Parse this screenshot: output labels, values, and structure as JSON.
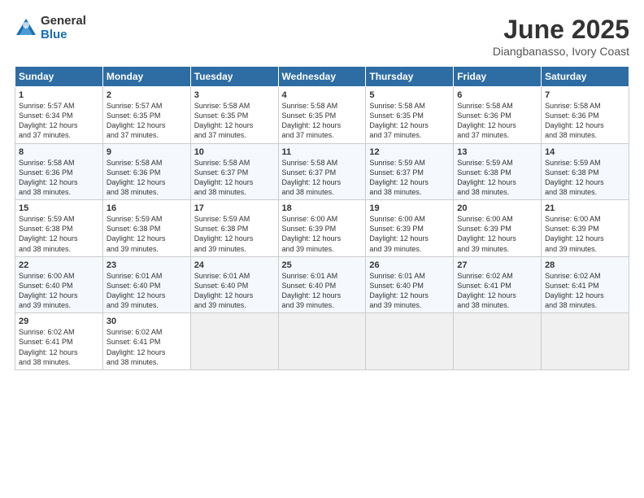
{
  "logo": {
    "general": "General",
    "blue": "Blue"
  },
  "title": "June 2025",
  "subtitle": "Diangbanasso, Ivory Coast",
  "header_days": [
    "Sunday",
    "Monday",
    "Tuesday",
    "Wednesday",
    "Thursday",
    "Friday",
    "Saturday"
  ],
  "weeks": [
    [
      {
        "day": "1",
        "lines": [
          "Sunrise: 5:57 AM",
          "Sunset: 6:34 PM",
          "Daylight: 12 hours",
          "and 37 minutes."
        ]
      },
      {
        "day": "2",
        "lines": [
          "Sunrise: 5:57 AM",
          "Sunset: 6:35 PM",
          "Daylight: 12 hours",
          "and 37 minutes."
        ]
      },
      {
        "day": "3",
        "lines": [
          "Sunrise: 5:58 AM",
          "Sunset: 6:35 PM",
          "Daylight: 12 hours",
          "and 37 minutes."
        ]
      },
      {
        "day": "4",
        "lines": [
          "Sunrise: 5:58 AM",
          "Sunset: 6:35 PM",
          "Daylight: 12 hours",
          "and 37 minutes."
        ]
      },
      {
        "day": "5",
        "lines": [
          "Sunrise: 5:58 AM",
          "Sunset: 6:35 PM",
          "Daylight: 12 hours",
          "and 37 minutes."
        ]
      },
      {
        "day": "6",
        "lines": [
          "Sunrise: 5:58 AM",
          "Sunset: 6:36 PM",
          "Daylight: 12 hours",
          "and 37 minutes."
        ]
      },
      {
        "day": "7",
        "lines": [
          "Sunrise: 5:58 AM",
          "Sunset: 6:36 PM",
          "Daylight: 12 hours",
          "and 38 minutes."
        ]
      }
    ],
    [
      {
        "day": "8",
        "lines": [
          "Sunrise: 5:58 AM",
          "Sunset: 6:36 PM",
          "Daylight: 12 hours",
          "and 38 minutes."
        ]
      },
      {
        "day": "9",
        "lines": [
          "Sunrise: 5:58 AM",
          "Sunset: 6:36 PM",
          "Daylight: 12 hours",
          "and 38 minutes."
        ]
      },
      {
        "day": "10",
        "lines": [
          "Sunrise: 5:58 AM",
          "Sunset: 6:37 PM",
          "Daylight: 12 hours",
          "and 38 minutes."
        ]
      },
      {
        "day": "11",
        "lines": [
          "Sunrise: 5:58 AM",
          "Sunset: 6:37 PM",
          "Daylight: 12 hours",
          "and 38 minutes."
        ]
      },
      {
        "day": "12",
        "lines": [
          "Sunrise: 5:59 AM",
          "Sunset: 6:37 PM",
          "Daylight: 12 hours",
          "and 38 minutes."
        ]
      },
      {
        "day": "13",
        "lines": [
          "Sunrise: 5:59 AM",
          "Sunset: 6:38 PM",
          "Daylight: 12 hours",
          "and 38 minutes."
        ]
      },
      {
        "day": "14",
        "lines": [
          "Sunrise: 5:59 AM",
          "Sunset: 6:38 PM",
          "Daylight: 12 hours",
          "and 38 minutes."
        ]
      }
    ],
    [
      {
        "day": "15",
        "lines": [
          "Sunrise: 5:59 AM",
          "Sunset: 6:38 PM",
          "Daylight: 12 hours",
          "and 38 minutes."
        ]
      },
      {
        "day": "16",
        "lines": [
          "Sunrise: 5:59 AM",
          "Sunset: 6:38 PM",
          "Daylight: 12 hours",
          "and 39 minutes."
        ]
      },
      {
        "day": "17",
        "lines": [
          "Sunrise: 5:59 AM",
          "Sunset: 6:38 PM",
          "Daylight: 12 hours",
          "and 39 minutes."
        ]
      },
      {
        "day": "18",
        "lines": [
          "Sunrise: 6:00 AM",
          "Sunset: 6:39 PM",
          "Daylight: 12 hours",
          "and 39 minutes."
        ]
      },
      {
        "day": "19",
        "lines": [
          "Sunrise: 6:00 AM",
          "Sunset: 6:39 PM",
          "Daylight: 12 hours",
          "and 39 minutes."
        ]
      },
      {
        "day": "20",
        "lines": [
          "Sunrise: 6:00 AM",
          "Sunset: 6:39 PM",
          "Daylight: 12 hours",
          "and 39 minutes."
        ]
      },
      {
        "day": "21",
        "lines": [
          "Sunrise: 6:00 AM",
          "Sunset: 6:39 PM",
          "Daylight: 12 hours",
          "and 39 minutes."
        ]
      }
    ],
    [
      {
        "day": "22",
        "lines": [
          "Sunrise: 6:00 AM",
          "Sunset: 6:40 PM",
          "Daylight: 12 hours",
          "and 39 minutes."
        ]
      },
      {
        "day": "23",
        "lines": [
          "Sunrise: 6:01 AM",
          "Sunset: 6:40 PM",
          "Daylight: 12 hours",
          "and 39 minutes."
        ]
      },
      {
        "day": "24",
        "lines": [
          "Sunrise: 6:01 AM",
          "Sunset: 6:40 PM",
          "Daylight: 12 hours",
          "and 39 minutes."
        ]
      },
      {
        "day": "25",
        "lines": [
          "Sunrise: 6:01 AM",
          "Sunset: 6:40 PM",
          "Daylight: 12 hours",
          "and 39 minutes."
        ]
      },
      {
        "day": "26",
        "lines": [
          "Sunrise: 6:01 AM",
          "Sunset: 6:40 PM",
          "Daylight: 12 hours",
          "and 39 minutes."
        ]
      },
      {
        "day": "27",
        "lines": [
          "Sunrise: 6:02 AM",
          "Sunset: 6:41 PM",
          "Daylight: 12 hours",
          "and 38 minutes."
        ]
      },
      {
        "day": "28",
        "lines": [
          "Sunrise: 6:02 AM",
          "Sunset: 6:41 PM",
          "Daylight: 12 hours",
          "and 38 minutes."
        ]
      }
    ],
    [
      {
        "day": "29",
        "lines": [
          "Sunrise: 6:02 AM",
          "Sunset: 6:41 PM",
          "Daylight: 12 hours",
          "and 38 minutes."
        ]
      },
      {
        "day": "30",
        "lines": [
          "Sunrise: 6:02 AM",
          "Sunset: 6:41 PM",
          "Daylight: 12 hours",
          "and 38 minutes."
        ]
      },
      {
        "day": "",
        "lines": []
      },
      {
        "day": "",
        "lines": []
      },
      {
        "day": "",
        "lines": []
      },
      {
        "day": "",
        "lines": []
      },
      {
        "day": "",
        "lines": []
      }
    ]
  ]
}
